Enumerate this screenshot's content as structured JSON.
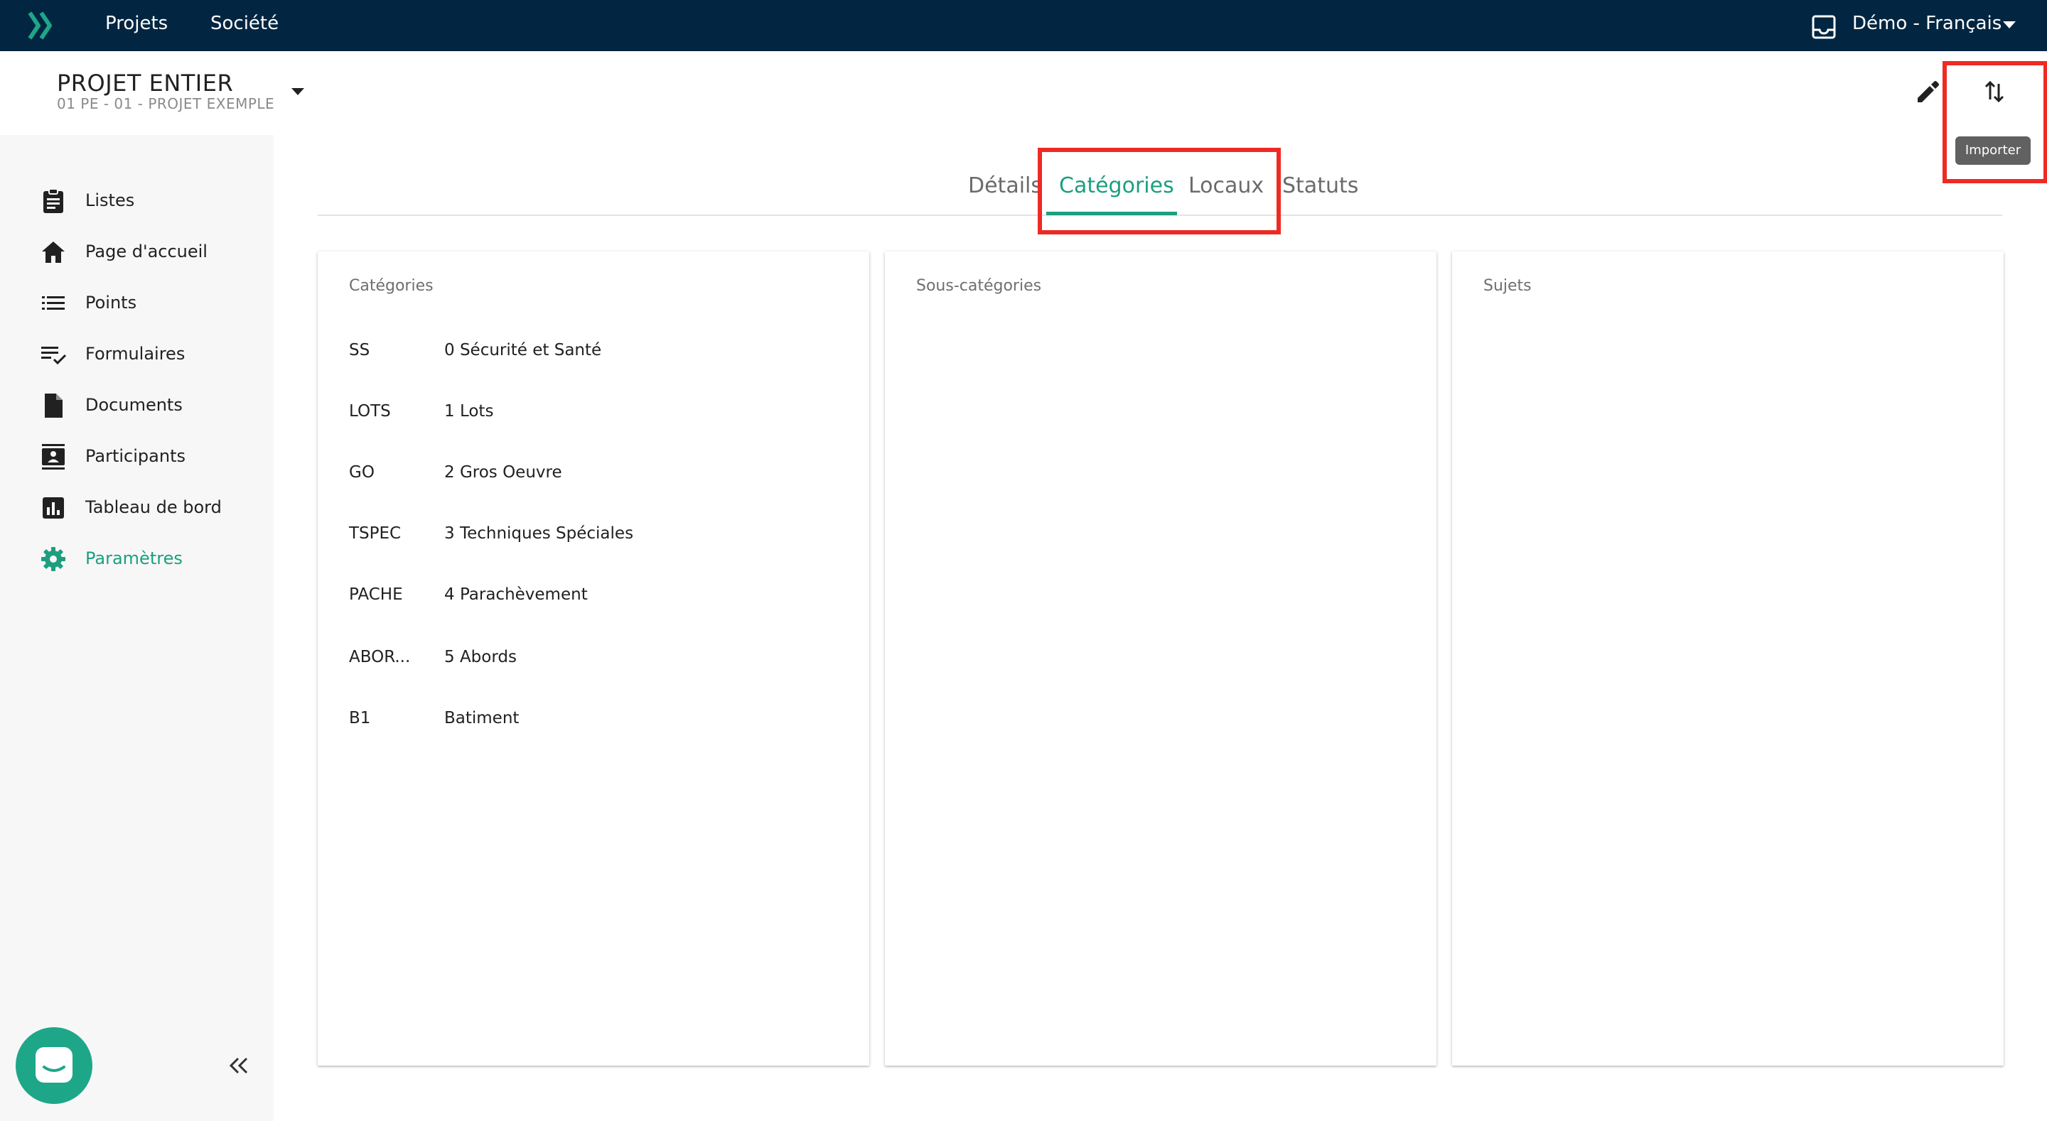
{
  "topbar": {
    "nav": [
      "Projets",
      "Société"
    ],
    "user_label": "Démo - Français",
    "background": "#022641",
    "logo_color": "#1ea689"
  },
  "project": {
    "title": "PROJET ENTIER",
    "subtitle": "01 PE - 01 - PROJET EXEMPLE"
  },
  "actions": {
    "import_tooltip": "Importer"
  },
  "sidebar": {
    "items": [
      {
        "label": "Listes",
        "icon": "clipboard-icon",
        "active": false
      },
      {
        "label": "Page d'accueil",
        "icon": "home-icon",
        "active": false
      },
      {
        "label": "Points",
        "icon": "list-icon",
        "active": false
      },
      {
        "label": "Formulaires",
        "icon": "checklist-icon",
        "active": false
      },
      {
        "label": "Documents",
        "icon": "document-icon",
        "active": false
      },
      {
        "label": "Participants",
        "icon": "contact-icon",
        "active": false
      },
      {
        "label": "Tableau de bord",
        "icon": "bar-chart-icon",
        "active": false
      },
      {
        "label": "Paramètres",
        "icon": "gear-icon",
        "active": true
      }
    ],
    "accent": "#1c9f7e"
  },
  "tabs": [
    {
      "label": "Détails",
      "active": false
    },
    {
      "label": "Catégories",
      "active": true
    },
    {
      "label": "Locaux",
      "active": false
    },
    {
      "label": "Statuts",
      "active": false
    }
  ],
  "panels": {
    "categories": {
      "title": "Catégories",
      "rows": [
        {
          "code": "SS",
          "name": "0 Sécurité et Santé"
        },
        {
          "code": "LOTS",
          "name": "1 Lots"
        },
        {
          "code": "GO",
          "name": "2 Gros Oeuvre"
        },
        {
          "code": "TSPEC",
          "name": "3 Techniques Spéciales"
        },
        {
          "code": "PACHE",
          "name": "4 Parachèvement"
        },
        {
          "code": "ABOR...",
          "name": "5 Abords"
        },
        {
          "code": "B1",
          "name": "Batiment"
        }
      ]
    },
    "subcategories": {
      "title": "Sous-catégories"
    },
    "subjects": {
      "title": "Sujets"
    }
  },
  "annotation_color": "#ee2a24"
}
